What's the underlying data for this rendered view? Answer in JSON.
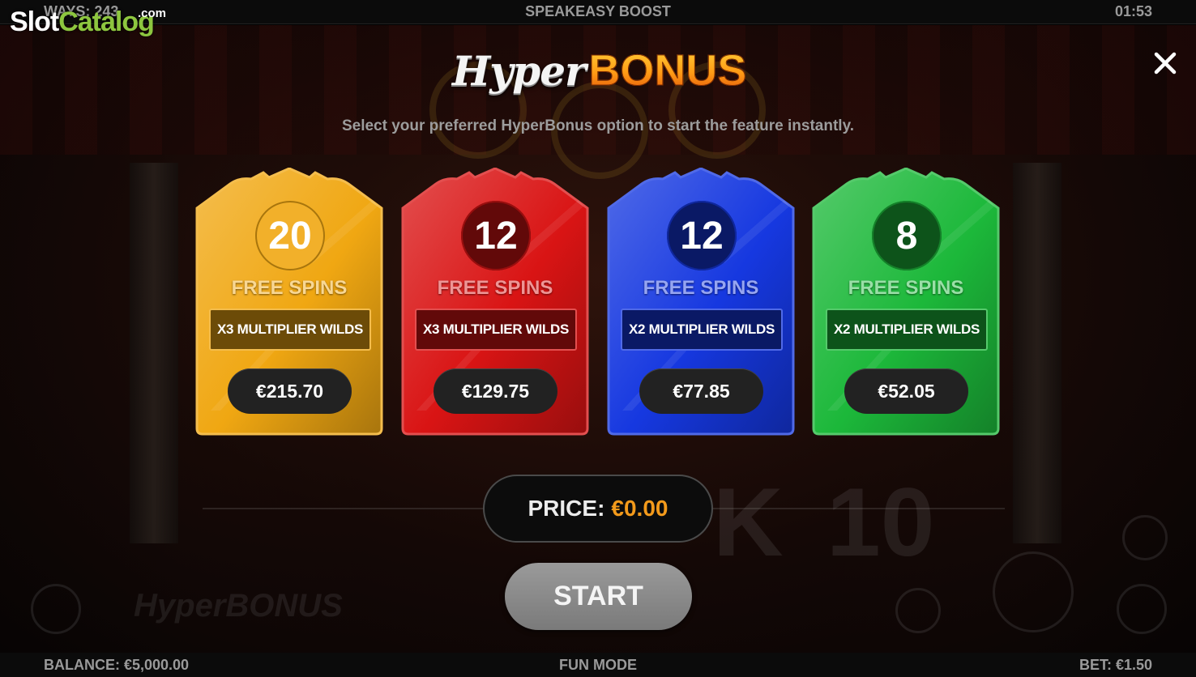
{
  "top_bar": {
    "ways": "WAYS: 243",
    "title": "SPEAKEASY BOOST",
    "time": "01:53"
  },
  "watermark": {
    "slot": "Slot",
    "catalog": "Catalog",
    "dotcom": ".com"
  },
  "dialog": {
    "logo_hyper": "Hyper",
    "logo_bonus": "BONUS",
    "subtitle": "Select your preferred HyperBonus option to start the feature instantly.",
    "options": [
      {
        "spins": "20",
        "label": "FREE SPINS",
        "multiplier": "X3 MULTIPLIER WILDS",
        "price": "€215.70",
        "color": "#f0a712"
      },
      {
        "spins": "12",
        "label": "FREE SPINS",
        "multiplier": "X3 MULTIPLIER WILDS",
        "price": "€129.75",
        "color": "#d91414"
      },
      {
        "spins": "12",
        "label": "FREE SPINS",
        "multiplier": "X2 MULTIPLIER WILDS",
        "price": "€77.85",
        "color": "#1638e0"
      },
      {
        "spins": "8",
        "label": "FREE SPINS",
        "multiplier": "X2 MULTIPLIER WILDS",
        "price": "€52.05",
        "color": "#1cb83a"
      }
    ],
    "price_label": "PRICE:",
    "price_value": "€0.00",
    "start_label": "START",
    "close_icon": "close-icon"
  },
  "bottom_bar": {
    "balance": "BALANCE: €5,000.00",
    "mode": "FUN MODE",
    "bet": "BET: €1.50"
  },
  "background": {
    "hyperbonus_text": "HyperBONUS"
  }
}
